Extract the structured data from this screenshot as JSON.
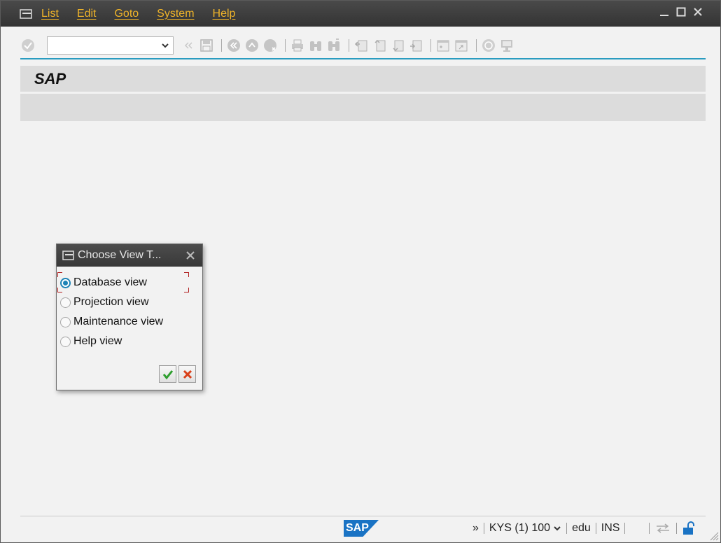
{
  "menubar": {
    "items": [
      "List",
      "Edit",
      "Goto",
      "System",
      "Help"
    ]
  },
  "toolbar": {
    "command_value": "",
    "icons": [
      "enter-icon",
      "command-dropdown",
      "back-arrows-icon",
      "save-icon",
      "back-icon",
      "exit-icon",
      "cancel-icon",
      "print-icon",
      "find-icon",
      "find-next-icon",
      "first-page-icon",
      "previous-page-icon",
      "next-page-icon",
      "last-page-icon",
      "create-session-icon",
      "shortcut-icon",
      "help-icon",
      "customize-layout-icon"
    ]
  },
  "screen": {
    "title": "SAP"
  },
  "dialog": {
    "title": "Choose View T...",
    "options": [
      {
        "label": "Database view",
        "selected": true
      },
      {
        "label": "Projection view",
        "selected": false
      },
      {
        "label": "Maintenance view",
        "selected": false
      },
      {
        "label": "Help view",
        "selected": false
      }
    ],
    "buttons": [
      "continue",
      "cancel"
    ]
  },
  "statusbar": {
    "logo": "SAP",
    "expand": "»",
    "system": "KYS (1) 100",
    "server": "edu",
    "mode": "INS"
  },
  "colors": {
    "menubar_bg": "#3c3c3c",
    "menu_text": "#f0b429",
    "accent_line": "#2a9cc0",
    "radio_selected": "#1d83b6",
    "sap_logo": "#1a73c4"
  }
}
